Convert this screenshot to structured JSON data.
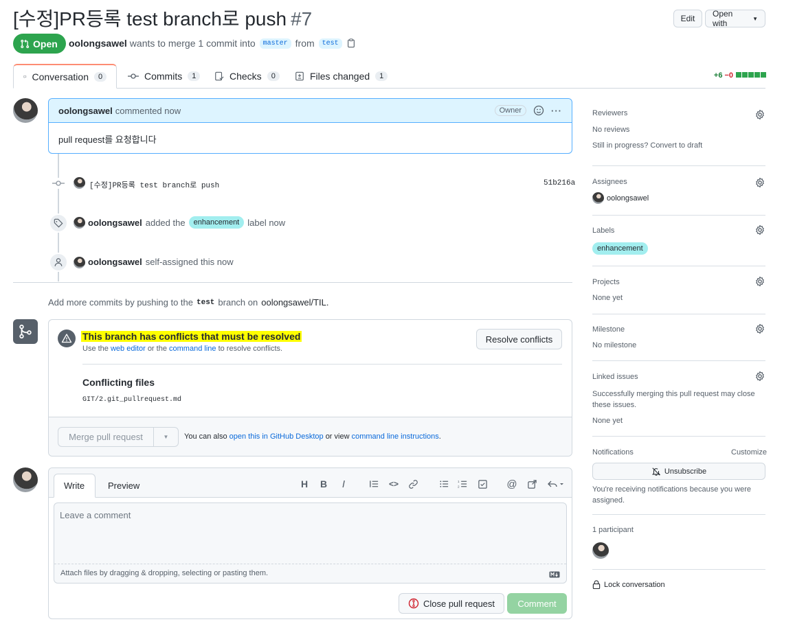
{
  "header": {
    "title": "[수정]PR등록 test branch로 push",
    "number": "#7",
    "edit_label": "Edit",
    "open_with_label": "Open with",
    "state": "Open",
    "author": "oolongsawel",
    "merge_text": "wants to merge 1 commit into",
    "base_branch": "master",
    "from_text": "from",
    "head_branch": "test"
  },
  "tabs": [
    {
      "label": "Conversation",
      "count": "0"
    },
    {
      "label": "Commits",
      "count": "1"
    },
    {
      "label": "Checks",
      "count": "0"
    },
    {
      "label": "Files changed",
      "count": "1"
    }
  ],
  "diffstat": {
    "additions": "+6",
    "deletions": "−0"
  },
  "comment": {
    "author": "oolongsawel",
    "action": "commented now",
    "badge": "Owner",
    "body": "pull request를 요청합니다"
  },
  "timeline": {
    "commit_message": "[수정]PR등록 test branch로 push",
    "commit_sha": "51b216a",
    "label_event": {
      "user": "oolongsawel",
      "pre": "added the",
      "label": "enhancement",
      "post": "label now"
    },
    "assign_event": {
      "user": "oolongsawel",
      "text": "self-assigned this now"
    }
  },
  "push_hint": {
    "pre": "Add more commits by pushing to the",
    "branch": "test",
    "mid": "branch on",
    "repo": "oolongsawel/TIL",
    "end": "."
  },
  "merge": {
    "conflict_title": "This branch has conflicts that must be resolved",
    "use_the": "Use the",
    "web_editor": "web editor",
    "or_the": "or the",
    "command_line": "command line",
    "to_resolve": "to resolve conflicts.",
    "resolve_button": "Resolve conflicts",
    "conflicting_files_heading": "Conflicting files",
    "conflicting_file": "GIT/2.git_pullrequest.md",
    "merge_button": "Merge pull request",
    "also_text": "You can also",
    "desktop_link": "open this in GitHub Desktop",
    "or_view": "or view",
    "instructions_link": "command line instructions",
    "end": "."
  },
  "editor": {
    "write_tab": "Write",
    "preview_tab": "Preview",
    "placeholder": "Leave a comment",
    "attach_text": "Attach files by dragging & dropping, selecting or pasting them.",
    "close_button": "Close pull request",
    "comment_button": "Comment"
  },
  "sidebar": {
    "reviewers": {
      "title": "Reviewers",
      "line1": "No reviews",
      "line2": "Still in progress? Convert to draft"
    },
    "assignees": {
      "title": "Assignees",
      "user": "oolongsawel"
    },
    "labels": {
      "title": "Labels",
      "label": "enhancement"
    },
    "projects": {
      "title": "Projects",
      "value": "None yet"
    },
    "milestone": {
      "title": "Milestone",
      "value": "No milestone"
    },
    "linked_issues": {
      "title": "Linked issues",
      "text": "Successfully merging this pull request may close these issues.",
      "value": "None yet"
    },
    "notifications": {
      "title": "Notifications",
      "customize": "Customize",
      "button": "Unsubscribe",
      "text": "You're receiving notifications because you were assigned."
    },
    "participants": {
      "title": "1 participant"
    },
    "lock": "Lock conversation"
  },
  "colors": {
    "open_green": "#2da44e",
    "accent_blue": "#0969da",
    "label_bg": "#a2eeef",
    "highlight": "#ffff00"
  }
}
